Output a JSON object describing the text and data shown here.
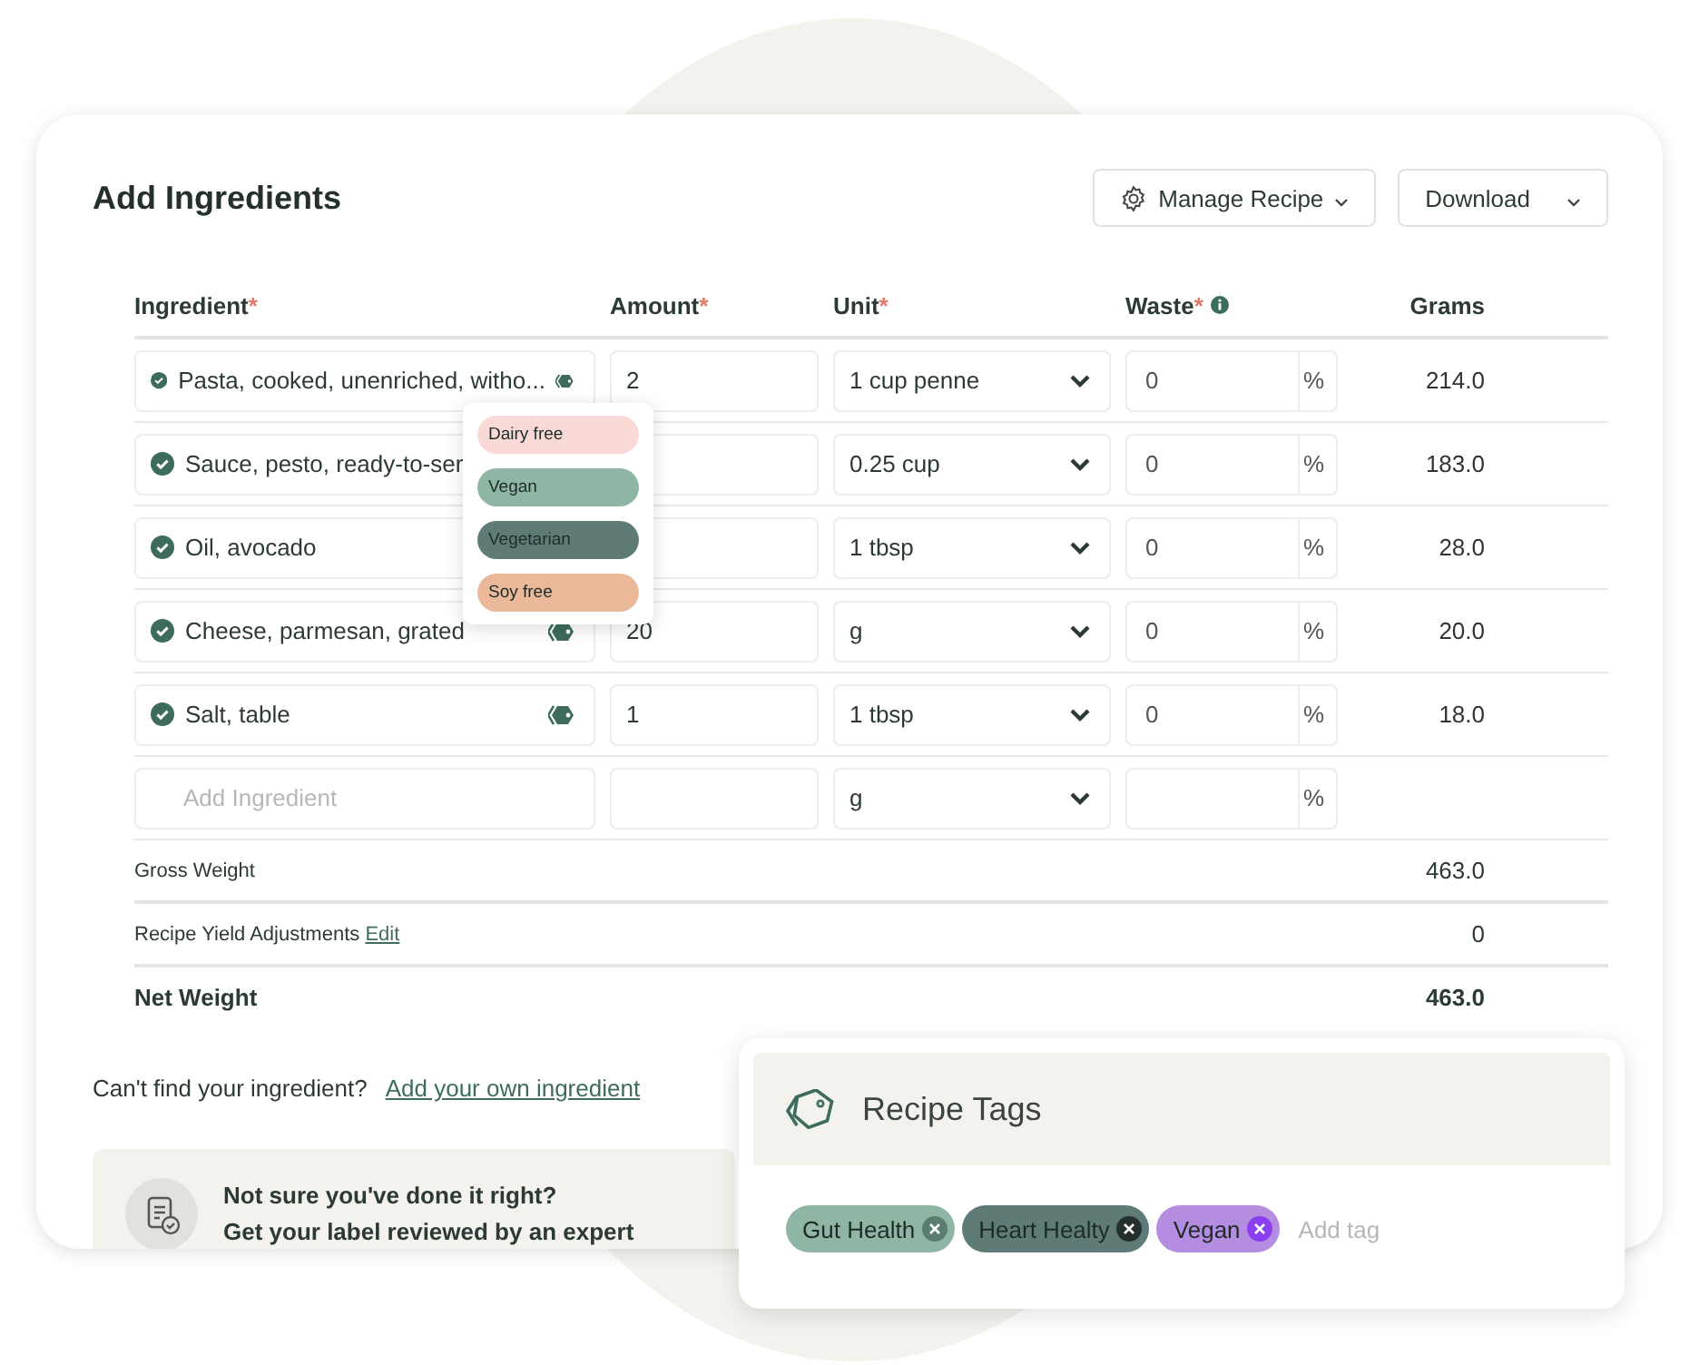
{
  "title": "Add Ingredients",
  "actions": [
    {
      "label": "Manage Recipe"
    },
    {
      "label": "Download"
    }
  ],
  "columns": [
    {
      "label": "Ingredient",
      "mark": "*",
      "info": false
    },
    {
      "label": "Amount",
      "mark": "*",
      "info": false
    },
    {
      "label": "Unit",
      "mark": "*",
      "info": false
    },
    {
      "label": "Waste",
      "mark": "*",
      "info": true
    },
    {
      "label": "Grams",
      "info": false
    }
  ],
  "rows": [
    {
      "ingredient": "Pasta, cooked, unenriched, witho...",
      "kind": "tagged",
      "amount": "2",
      "unit": "1 cup penne",
      "waste": "0",
      "grams": "214.0"
    },
    {
      "ingredient": "Sauce, pesto, ready-to-ser",
      "kind": "plain",
      "unit": "0.25 cup",
      "waste": "0",
      "grams": "183.0"
    },
    {
      "ingredient": "Oil, avocado",
      "kind": "plain",
      "unit": "1 tbsp",
      "waste": "0",
      "grams": "28.0"
    },
    {
      "ingredient": "Cheese, parmesan, grated",
      "kind": "tagged",
      "amount": "20",
      "unit": "g",
      "waste": "0",
      "grams": "20.0"
    },
    {
      "ingredient": "Salt, table",
      "kind": "tagged",
      "amount": "1",
      "unit": "1 tbsp",
      "waste": "0",
      "grams": "18.0"
    }
  ],
  "new_row": {
    "placeholder": "Add Ingredient",
    "unit": "g"
  },
  "percent": "%",
  "totals": [
    {
      "label": "Gross Weight",
      "value": "463.0",
      "bold": false
    },
    {
      "label": "Recipe Yield Adjustments",
      "link": "Edit",
      "value": "0",
      "bold": false
    },
    {
      "label": "Net Weight",
      "value": "463.0",
      "bold": true
    }
  ],
  "footer": {
    "question": "Can't find your ingredient?",
    "link": "Add your own ingredient"
  },
  "expert": {
    "line_1": "Not sure you've done it right?",
    "line_2": "Get your label reviewed by an expert"
  },
  "tag_menu": [
    {
      "label": "Dairy free",
      "color": "#f9d9d6"
    },
    {
      "label": "Vegan",
      "color": "#8fb5a5"
    },
    {
      "label": "Vegetarian",
      "color": "#5f7b78"
    },
    {
      "label": "Soy free",
      "color": "#ebb99a"
    }
  ],
  "recipe_tags": {
    "title": "Recipe Tags",
    "placeholder": "Add tag",
    "tags": [
      {
        "label": "Gut Health",
        "color": "#8fb5a5"
      },
      {
        "label": "Heart Healty",
        "color": "#5f7b78"
      },
      {
        "label": "Vegan",
        "color": "#b48de0"
      }
    ]
  }
}
